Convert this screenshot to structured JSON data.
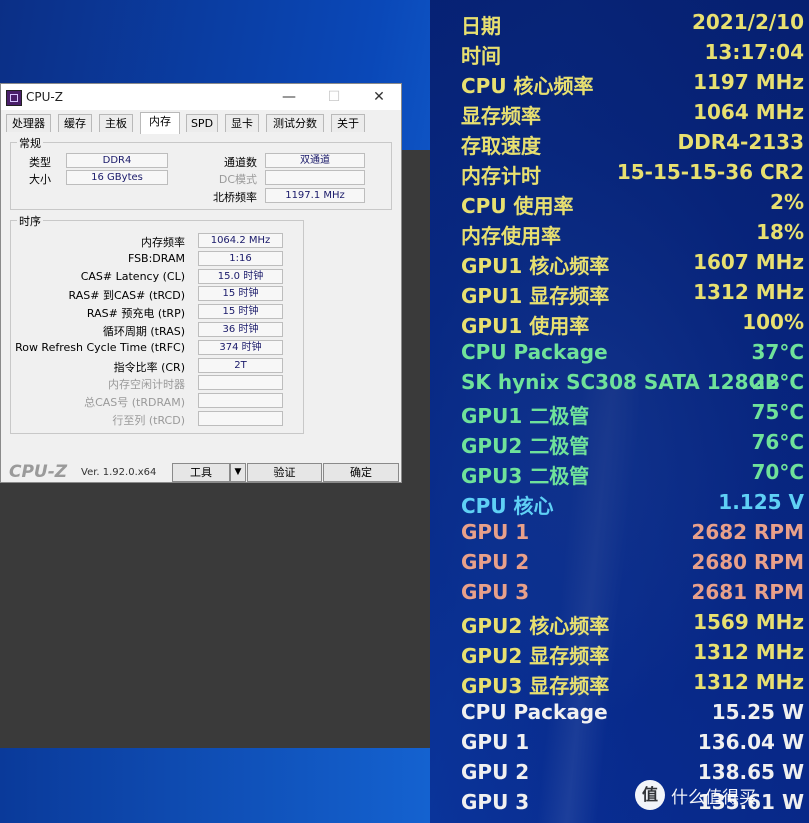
{
  "window": {
    "title": "CPU-Z",
    "tabs": [
      "处理器",
      "缓存",
      "主板",
      "内存",
      "SPD",
      "显卡",
      "测试分数",
      "关于"
    ],
    "active_tab": "内存"
  },
  "general": {
    "group_title": "常规",
    "type_label": "类型",
    "type_value": "DDR4",
    "size_label": "大小",
    "size_value": "16 GBytes",
    "channels_label": "通道数",
    "channels_value": "双通道",
    "dc_mode_label": "DC模式",
    "dc_mode_value": "",
    "nb_freq_label": "北桥频率",
    "nb_freq_value": "1197.1 MHz"
  },
  "timings": {
    "group_title": "时序",
    "rows": [
      {
        "label": "内存频率",
        "value": "1064.2 MHz",
        "enabled": true
      },
      {
        "label": "FSB:DRAM",
        "value": "1:16",
        "enabled": true
      },
      {
        "label": "CAS# Latency (CL)",
        "value": "15.0 时钟",
        "enabled": true
      },
      {
        "label": "RAS# 到CAS# (tRCD)",
        "value": "15 时钟",
        "enabled": true
      },
      {
        "label": "RAS# 预充电 (tRP)",
        "value": "15 时钟",
        "enabled": true
      },
      {
        "label": "循环周期 (tRAS)",
        "value": "36 时钟",
        "enabled": true
      },
      {
        "label": "Row Refresh Cycle Time (tRFC)",
        "value": "374 时钟",
        "enabled": true
      },
      {
        "label": "指令比率 (CR)",
        "value": "2T",
        "enabled": true
      },
      {
        "label": "内存空闲计时器",
        "value": "",
        "enabled": false
      },
      {
        "label": "总CAS号 (tRDRAM)",
        "value": "",
        "enabled": false
      },
      {
        "label": "行至列 (tRCD)",
        "value": "",
        "enabled": false
      }
    ]
  },
  "footer": {
    "logo": "CPU-Z",
    "version": "Ver. 1.92.0.x64",
    "tools_label": "工具",
    "dropdown_arrow": "▼",
    "validate_label": "验证",
    "ok_label": "确定"
  },
  "osd": [
    {
      "label": "日期",
      "value": "2021/2/10",
      "color": "#e8e070"
    },
    {
      "label": "时间",
      "value": "13:17:04",
      "color": "#e8e070"
    },
    {
      "label": "CPU 核心频率",
      "value": "1197 MHz",
      "color": "#e8e070"
    },
    {
      "label": "显存频率",
      "value": "1064 MHz",
      "color": "#e8e070"
    },
    {
      "label": "存取速度",
      "value": "DDR4-2133",
      "color": "#e8e070"
    },
    {
      "label": "内存计时",
      "value": "15-15-15-36 CR2",
      "color": "#e8e070"
    },
    {
      "label": "CPU 使用率",
      "value": "2%",
      "color": "#e8e070"
    },
    {
      "label": "内存使用率",
      "value": "18%",
      "color": "#e8e070"
    },
    {
      "label": "GPU1 核心频率",
      "value": "1607 MHz",
      "color": "#e8e070"
    },
    {
      "label": "GPU1 显存频率",
      "value": "1312 MHz",
      "color": "#e8e070"
    },
    {
      "label": "GPU1 使用率",
      "value": "100%",
      "color": "#e8e070"
    },
    {
      "label": "CPU Package",
      "value": "37°C",
      "color": "#6fe29a"
    },
    {
      "label": "SK hynix SC308 SATA 128GB",
      "value": "22°C",
      "color": "#6fe29a"
    },
    {
      "label": "GPU1 二极管",
      "value": "75°C",
      "color": "#6fe29a"
    },
    {
      "label": "GPU2 二极管",
      "value": "76°C",
      "color": "#6fe29a"
    },
    {
      "label": "GPU3 二极管",
      "value": "70°C",
      "color": "#6fe29a"
    },
    {
      "label": "CPU 核心",
      "value": "1.125 V",
      "color": "#5fd0f5"
    },
    {
      "label": "GPU 1",
      "value": "2682 RPM",
      "color": "#e8a08a"
    },
    {
      "label": "GPU 2",
      "value": "2680 RPM",
      "color": "#e8a08a"
    },
    {
      "label": "GPU 3",
      "value": "2681 RPM",
      "color": "#e8a08a"
    },
    {
      "label": "GPU2 核心频率",
      "value": "1569 MHz",
      "color": "#e8e070"
    },
    {
      "label": "GPU2 显存频率",
      "value": "1312 MHz",
      "color": "#e8e070"
    },
    {
      "label": "GPU3 显存频率",
      "value": "1312 MHz",
      "color": "#e8e070"
    },
    {
      "label": "CPU Package",
      "value": "15.25 W",
      "color": "#f0f0f0"
    },
    {
      "label": "GPU 1",
      "value": "136.04 W",
      "color": "#f0f0f0"
    },
    {
      "label": "GPU 2",
      "value": "138.65 W",
      "color": "#f0f0f0"
    },
    {
      "label": "GPU 3",
      "value": "135.61 W",
      "color": "#f0f0f0"
    }
  ],
  "watermark": {
    "icon_text": "值",
    "text": "什么值得买"
  }
}
